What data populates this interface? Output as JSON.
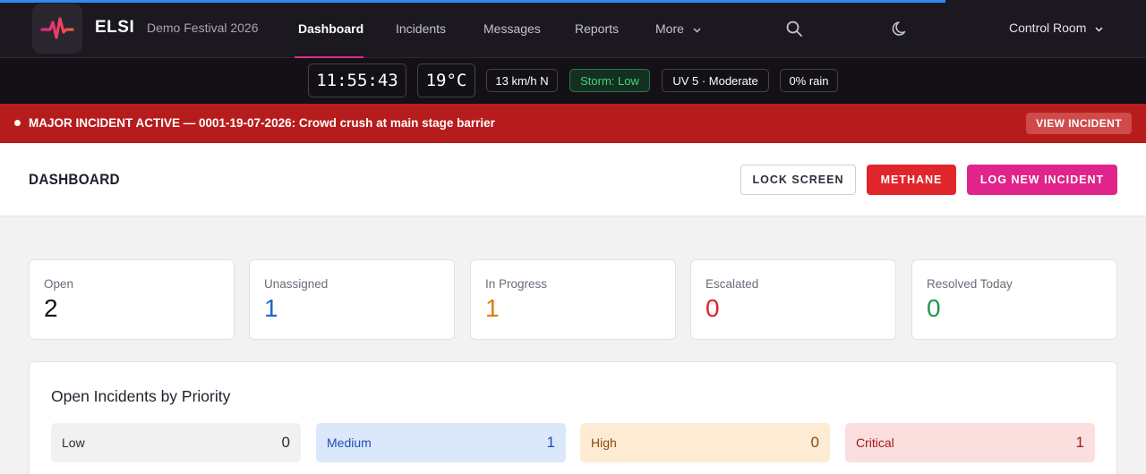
{
  "app": {
    "brand": "ELSI",
    "event_name": "Demo Festival 2026"
  },
  "nav": {
    "items": [
      {
        "label": "Dashboard",
        "active": true
      },
      {
        "label": "Incidents"
      },
      {
        "label": "Messages"
      },
      {
        "label": "Reports"
      },
      {
        "label": "More"
      }
    ],
    "icons": [
      "search-icon",
      "moon-icon"
    ],
    "control_room": "Control Room"
  },
  "conditions": {
    "time": "11:55:43",
    "temperature": "19°C",
    "wind": "13 km/h N",
    "storm": "Storm: Low",
    "uv": "UV 5 · Moderate",
    "rain": "0% rain"
  },
  "alert": {
    "message": "MAJOR INCIDENT ACTIVE — 0001-19-07-2026: Crowd crush at main stage barrier",
    "button": "VIEW INCIDENT"
  },
  "header": {
    "title": "DASHBOARD",
    "lock_label": "LOCK SCREEN",
    "methane_label": "METHANE",
    "log_label": "LOG NEW INCIDENT"
  },
  "stats": [
    {
      "label": "Open",
      "value": "2",
      "color": "#111318"
    },
    {
      "label": "Unassigned",
      "value": "1",
      "color": "#1e63d6"
    },
    {
      "label": "In Progress",
      "value": "1",
      "color": "#e07a12"
    },
    {
      "label": "Escalated",
      "value": "0",
      "color": "#d6262a"
    },
    {
      "label": "Resolved Today",
      "value": "0",
      "color": "#1f9a4a"
    }
  ],
  "priority": {
    "title": "Open Incidents by Priority",
    "items": [
      {
        "label": "Low",
        "value": "0",
        "bg": "#f1f1f2",
        "fg": "#2a2c33"
      },
      {
        "label": "Medium",
        "value": "1",
        "bg": "#dbe7fb",
        "fg": "#1d4fb0"
      },
      {
        "label": "High",
        "value": "0",
        "bg": "#fdebd3",
        "fg": "#8a4a12"
      },
      {
        "label": "Critical",
        "value": "1",
        "bg": "#fbdede",
        "fg": "#a3191d"
      }
    ]
  }
}
